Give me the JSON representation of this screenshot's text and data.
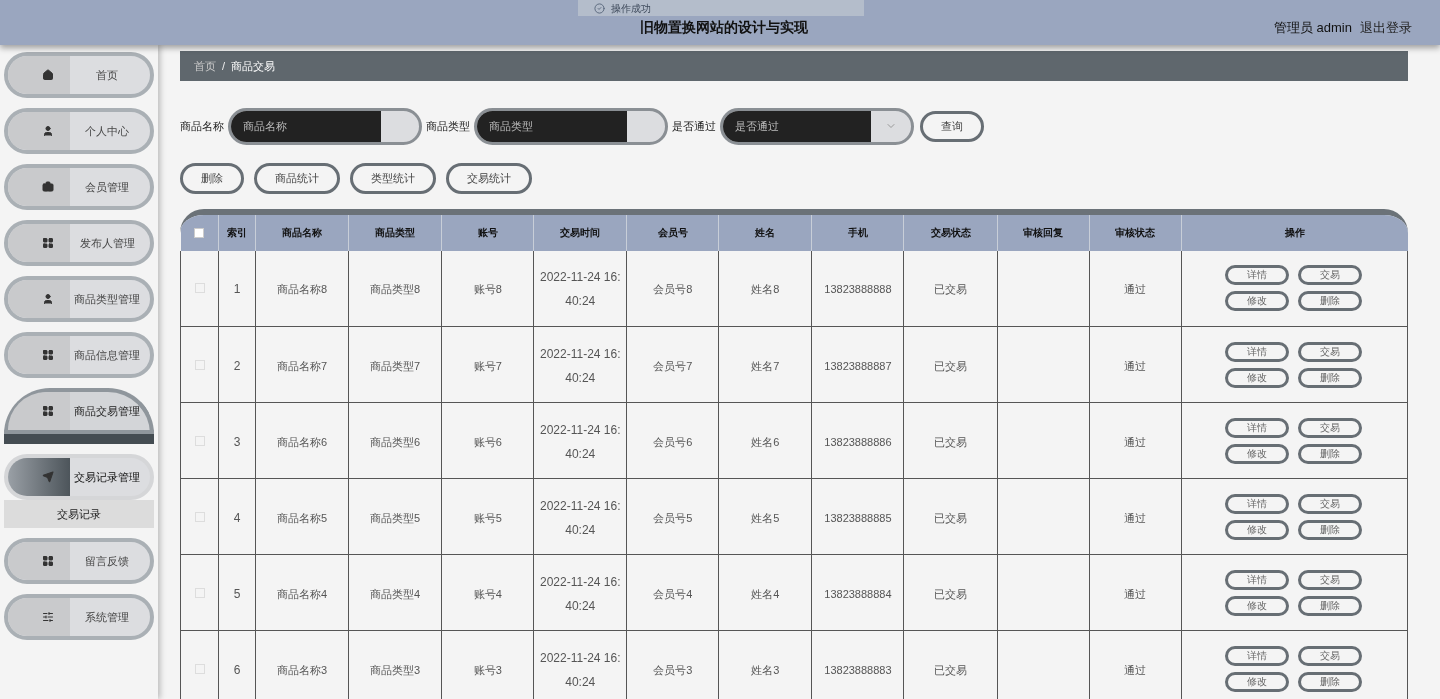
{
  "header": {
    "title": "旧物置换网站的设计与实现",
    "user": "管理员 admin",
    "logout": "退出登录"
  },
  "toast": {
    "text": "操作成功"
  },
  "sidebar": {
    "items": [
      {
        "label": "首页",
        "selected": false,
        "expanded": false
      },
      {
        "label": "个人中心",
        "selected": false,
        "expanded": false
      },
      {
        "label": "会员管理",
        "selected": false,
        "expanded": false
      },
      {
        "label": "发布人管理",
        "selected": false,
        "expanded": false
      },
      {
        "label": "商品类型管理",
        "selected": false,
        "expanded": false
      },
      {
        "label": "商品信息管理",
        "selected": false,
        "expanded": false
      },
      {
        "label": "商品交易管理",
        "selected": true,
        "expanded": false
      },
      {
        "label": "交易记录管理",
        "selected": false,
        "expanded": true,
        "children": [
          {
            "label": "交易记录"
          }
        ]
      },
      {
        "label": "留言反馈",
        "selected": false,
        "expanded": false
      },
      {
        "label": "系统管理",
        "selected": false,
        "expanded": false
      }
    ]
  },
  "breadcrumb": [
    "首页",
    "商品交易"
  ],
  "breadcrumb_separator": "/",
  "search": {
    "fields": [
      {
        "kind": "input",
        "label": "商品名称",
        "placeholder": "商品名称"
      },
      {
        "kind": "input",
        "label": "商品类型",
        "placeholder": "商品类型"
      },
      {
        "kind": "select",
        "label": "是否通过",
        "placeholder": "是否通过"
      }
    ],
    "button": "查询"
  },
  "actions": [
    "删除",
    "商品统计",
    "类型统计",
    "交易统计"
  ],
  "table": {
    "header_checked": false,
    "columns": [
      "索引",
      "商品名称",
      "商品类型",
      "账号",
      "交易时间",
      "会员号",
      "姓名",
      "手机",
      "交易状态",
      "审核回复",
      "审核状态",
      "操作"
    ],
    "rows": [
      {
        "checked": false,
        "cells": [
          "1",
          "商品名称8",
          "商品类型8",
          "账号8",
          "2022-11-24 16:40:24",
          "会员号8",
          "姓名8",
          "13823888888",
          "已交易",
          "",
          "通过"
        ],
        "buttons": [
          "详情",
          "交易",
          "修改",
          "删除"
        ]
      },
      {
        "checked": false,
        "cells": [
          "2",
          "商品名称7",
          "商品类型7",
          "账号7",
          "2022-11-24 16:40:24",
          "会员号7",
          "姓名7",
          "13823888887",
          "已交易",
          "",
          "通过"
        ],
        "buttons": [
          "详情",
          "交易",
          "修改",
          "删除"
        ]
      },
      {
        "checked": false,
        "cells": [
          "3",
          "商品名称6",
          "商品类型6",
          "账号6",
          "2022-11-24 16:40:24",
          "会员号6",
          "姓名6",
          "13823888886",
          "已交易",
          "",
          "通过"
        ],
        "buttons": [
          "详情",
          "交易",
          "修改",
          "删除"
        ]
      },
      {
        "checked": false,
        "cells": [
          "4",
          "商品名称5",
          "商品类型5",
          "账号5",
          "2022-11-24 16:40:24",
          "会员号5",
          "姓名5",
          "13823888885",
          "已交易",
          "",
          "通过"
        ],
        "buttons": [
          "详情",
          "交易",
          "修改",
          "删除"
        ]
      },
      {
        "checked": false,
        "cells": [
          "5",
          "商品名称4",
          "商品类型4",
          "账号4",
          "2022-11-24 16:40:24",
          "会员号4",
          "姓名4",
          "13823888884",
          "已交易",
          "",
          "通过"
        ],
        "buttons": [
          "详情",
          "交易",
          "修改",
          "删除"
        ]
      },
      {
        "checked": false,
        "cells": [
          "6",
          "商品名称3",
          "商品类型3",
          "账号3",
          "2022-11-24 16:40:24",
          "会员号3",
          "姓名3",
          "13823888883",
          "已交易",
          "",
          "通过"
        ],
        "buttons": [
          "详情",
          "交易",
          "修改",
          "删除"
        ]
      }
    ]
  }
}
